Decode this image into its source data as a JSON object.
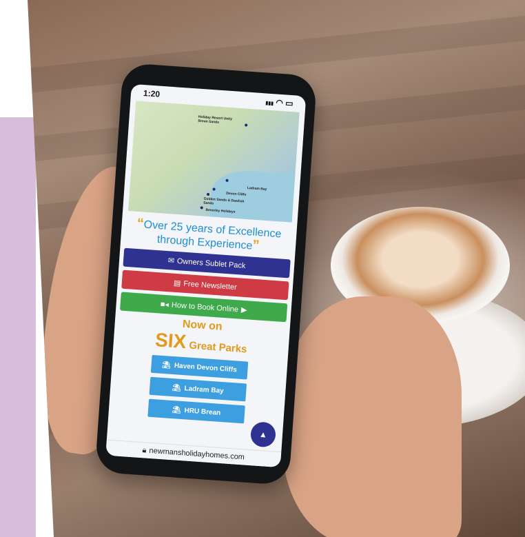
{
  "status_bar": {
    "time": "1:20",
    "signal": "▮▮▮",
    "wifi": "◠",
    "battery": "▭"
  },
  "map": {
    "labels": [
      "Holiday Resort Unity Brean Sands",
      "Ladram Bay",
      "Devon Cliffs",
      "Golden Sands & Dawlish Sands",
      "Beverley Holidays"
    ]
  },
  "tagline": {
    "open_quote": "“",
    "text": "Over 25 years of Excellence through Experience",
    "close_quote": "”"
  },
  "buttons": {
    "owners_sublet": "Owners Sublet Pack",
    "newsletter": "Free Newsletter",
    "how_to_book": "How to Book Online"
  },
  "parks_heading": {
    "line1": "Now on",
    "six": "SIX",
    "line2": "Great Parks"
  },
  "parks": [
    "Haven Devon Cliffs",
    "Ladram Bay",
    "HRU Brean"
  ],
  "url_bar": {
    "url": "newmansholidayhomes.com"
  },
  "colors": {
    "navy": "#2f3290",
    "red": "#cf3b45",
    "green": "#3faa4c",
    "orange": "#e39a1c",
    "blue": "#3d9fe0"
  }
}
